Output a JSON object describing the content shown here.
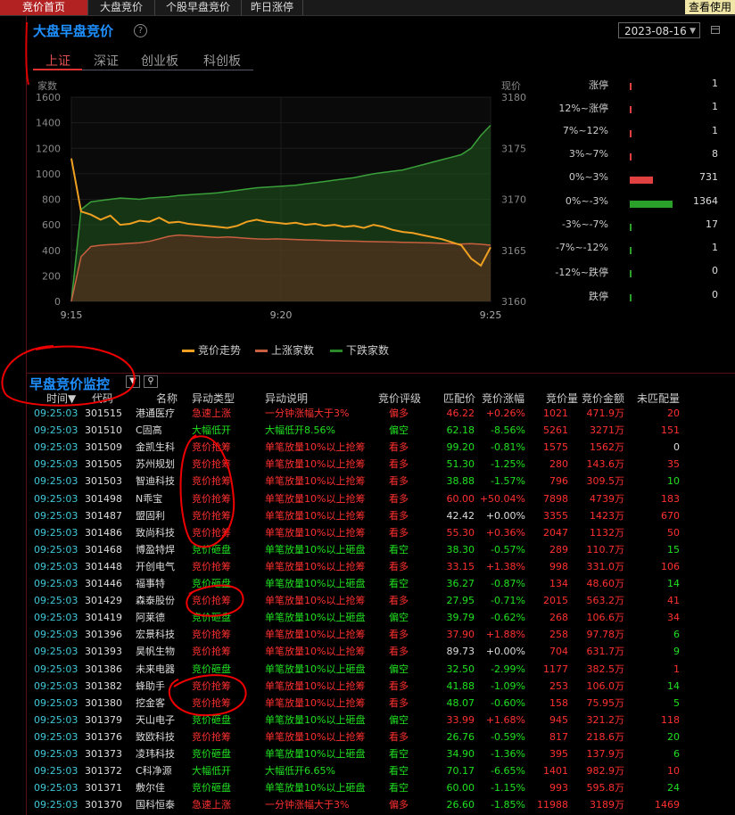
{
  "tabs": [
    "竞价首页",
    "大盘竞价",
    "个股早盘竞价",
    "昨日涨停"
  ],
  "help_label": "查看使用",
  "title": "大盘早盘竞价",
  "date": "2023-08-16",
  "markets": [
    "上证",
    "深证",
    "创业板",
    "科创板"
  ],
  "chart_data": {
    "type": "line",
    "x": [
      "9:15",
      "9:20",
      "9:25"
    ],
    "left_axis": {
      "label": "家数",
      "ticks": [
        1600,
        1400,
        1200,
        1000,
        800,
        600,
        400,
        200,
        0
      ]
    },
    "right_axis": {
      "label": "现价",
      "ticks": [
        3180,
        3175,
        3170,
        3165,
        3160
      ]
    },
    "series": [
      {
        "name": "竞价走势",
        "color": "#f0a020",
        "values": [
          3174,
          3168.8,
          3168.5,
          3168,
          3168.4,
          3167.5,
          3167.6,
          3167.9,
          3167.8,
          3168.2,
          3167.7,
          3167.8,
          3167.6,
          3167.5,
          3167.4,
          3167.3,
          3167.2,
          3167.4,
          3167.8,
          3168,
          3167.8,
          3167.7,
          3167.6,
          3167.7,
          3167.5,
          3167.6,
          3167.4,
          3167.5,
          3167.3,
          3167.4,
          3167.2,
          3167.5,
          3167.3,
          3167,
          3166.8,
          3166.7,
          3166.5,
          3166.3,
          3166.1,
          3165.8,
          3165.5,
          3164.2,
          3163.5,
          3165.3
        ]
      },
      {
        "name": "上涨家数",
        "color": "#c86040",
        "values": [
          0,
          350,
          430,
          440,
          445,
          450,
          455,
          460,
          470,
          490,
          510,
          520,
          515,
          510,
          505,
          500,
          505,
          500,
          495,
          490,
          488,
          490,
          488,
          485,
          482,
          480,
          478,
          476,
          474,
          472,
          470,
          468,
          466,
          465,
          463,
          462,
          460,
          458,
          455,
          452,
          450,
          452,
          448,
          440
        ]
      },
      {
        "name": "下跌家数",
        "color": "#2a8a2a",
        "values": [
          0,
          720,
          780,
          790,
          800,
          810,
          805,
          800,
          810,
          815,
          820,
          830,
          835,
          840,
          845,
          850,
          860,
          870,
          880,
          890,
          895,
          900,
          905,
          910,
          920,
          930,
          940,
          950,
          960,
          970,
          985,
          1000,
          1010,
          1020,
          1030,
          1050,
          1070,
          1090,
          1110,
          1130,
          1150,
          1200,
          1300,
          1380
        ]
      }
    ]
  },
  "legend": [
    "竞价走势",
    "上涨家数",
    "下跌家数"
  ],
  "distribution": [
    {
      "label": "涨停",
      "count": "1",
      "color": "#e04040",
      "frac": 0.002
    },
    {
      "label": "12%~涨停",
      "count": "1",
      "color": "#e04040",
      "frac": 0.002
    },
    {
      "label": "7%~12%",
      "count": "1",
      "color": "#e04040",
      "frac": 0.002
    },
    {
      "label": "3%~7%",
      "count": "8",
      "color": "#e04040",
      "frac": 0.006
    },
    {
      "label": "0%~3%",
      "count": "731",
      "color": "#e04040",
      "frac": 0.536
    },
    {
      "label": "0%~-3%",
      "count": "1364",
      "color": "#2aa02a",
      "frac": 1.0
    },
    {
      "label": "-3%~-7%",
      "count": "17",
      "color": "#2aa02a",
      "frac": 0.012
    },
    {
      "label": "-7%~-12%",
      "count": "1",
      "color": "#2aa02a",
      "frac": 0.002
    },
    {
      "label": "-12%~跌停",
      "count": "0",
      "color": "#2aa02a",
      "frac": 0.0
    },
    {
      "label": "跌停",
      "count": "0",
      "color": "#2aa02a",
      "frac": 0.0
    }
  ],
  "monitor": {
    "title": "早盘竞价监控",
    "headers": [
      "时间",
      "代码",
      "名称",
      "异动类型",
      "异动说明",
      "竞价评级",
      "匹配价",
      "竞价涨幅",
      "竞价量",
      "竞价金额",
      "未匹配量"
    ],
    "rows": [
      [
        "09:25:03",
        "301515",
        "港通医疗",
        "急速上涨",
        "一分钟涨幅大于3%",
        "偏多",
        "46.22",
        "+0.26%",
        "1021",
        "471.9万",
        "20"
      ],
      [
        "09:25:03",
        "301510",
        "C固高",
        "大幅低开",
        "大幅低开8.56%",
        "偏空",
        "62.18",
        "-8.56%",
        "5261",
        "3271万",
        "151"
      ],
      [
        "09:25:03",
        "301509",
        "金凯生科",
        "竞价抢筹",
        "单笔放量10%以上抢筹",
        "看多",
        "99.20",
        "-0.81%",
        "1575",
        "1562万",
        "0"
      ],
      [
        "09:25:03",
        "301505",
        "苏州规划",
        "竞价抢筹",
        "单笔放量10%以上抢筹",
        "看多",
        "51.30",
        "-1.25%",
        "280",
        "143.6万",
        "35"
      ],
      [
        "09:25:03",
        "301503",
        "智迪科技",
        "竞价抢筹",
        "单笔放量10%以上抢筹",
        "看多",
        "38.88",
        "-1.57%",
        "796",
        "309.5万",
        "10"
      ],
      [
        "09:25:03",
        "301498",
        "N乖宝",
        "竞价抢筹",
        "单笔放量10%以上抢筹",
        "看多",
        "60.00",
        "+50.04%",
        "7898",
        "4739万",
        "183"
      ],
      [
        "09:25:03",
        "301487",
        "盟固利",
        "竞价抢筹",
        "单笔放量10%以上抢筹",
        "看多",
        "42.42",
        "+0.00%",
        "3355",
        "1423万",
        "670"
      ],
      [
        "09:25:03",
        "301486",
        "致尚科技",
        "竞价抢筹",
        "单笔放量10%以上抢筹",
        "看多",
        "55.30",
        "+0.36%",
        "2047",
        "1132万",
        "50"
      ],
      [
        "09:25:03",
        "301468",
        "博盈特焊",
        "竞价砸盘",
        "单笔放量10%以上砸盘",
        "看空",
        "38.30",
        "-0.57%",
        "289",
        "110.7万",
        "15"
      ],
      [
        "09:25:03",
        "301448",
        "开创电气",
        "竞价抢筹",
        "单笔放量10%以上抢筹",
        "看多",
        "33.15",
        "+1.38%",
        "998",
        "331.0万",
        "106"
      ],
      [
        "09:25:03",
        "301446",
        "福事特",
        "竞价砸盘",
        "单笔放量10%以上砸盘",
        "看空",
        "36.27",
        "-0.87%",
        "134",
        "48.60万",
        "14"
      ],
      [
        "09:25:03",
        "301429",
        "森泰股份",
        "竞价抢筹",
        "单笔放量10%以上抢筹",
        "看多",
        "27.95",
        "-0.71%",
        "2015",
        "563.2万",
        "41"
      ],
      [
        "09:25:03",
        "301419",
        "阿莱德",
        "竞价砸盘",
        "单笔放量10%以上砸盘",
        "偏空",
        "39.79",
        "-0.62%",
        "268",
        "106.6万",
        "34"
      ],
      [
        "09:25:03",
        "301396",
        "宏景科技",
        "竞价抢筹",
        "单笔放量10%以上抢筹",
        "看多",
        "37.90",
        "+1.88%",
        "258",
        "97.78万",
        "6"
      ],
      [
        "09:25:03",
        "301393",
        "昊帆生物",
        "竞价抢筹",
        "单笔放量10%以上抢筹",
        "看多",
        "89.73",
        "+0.00%",
        "704",
        "631.7万",
        "9"
      ],
      [
        "09:25:03",
        "301386",
        "未来电器",
        "竞价砸盘",
        "单笔放量10%以上砸盘",
        "偏空",
        "32.50",
        "-2.99%",
        "1177",
        "382.5万",
        "1"
      ],
      [
        "09:25:03",
        "301382",
        "蜂助手",
        "竞价抢筹",
        "单笔放量10%以上抢筹",
        "看多",
        "41.88",
        "-1.09%",
        "253",
        "106.0万",
        "14"
      ],
      [
        "09:25:03",
        "301380",
        "挖金客",
        "竞价抢筹",
        "单笔放量10%以上抢筹",
        "看多",
        "48.07",
        "-0.60%",
        "158",
        "75.95万",
        "5"
      ],
      [
        "09:25:03",
        "301379",
        "天山电子",
        "竞价砸盘",
        "单笔放量10%以上砸盘",
        "偏空",
        "33.99",
        "+1.68%",
        "945",
        "321.2万",
        "118"
      ],
      [
        "09:25:03",
        "301376",
        "致欧科技",
        "竞价抢筹",
        "单笔放量10%以上抢筹",
        "看多",
        "26.76",
        "-0.59%",
        "817",
        "218.6万",
        "20"
      ],
      [
        "09:25:03",
        "301373",
        "凌玮科技",
        "竞价砸盘",
        "单笔放量10%以上砸盘",
        "看空",
        "34.90",
        "-1.36%",
        "395",
        "137.9万",
        "6"
      ],
      [
        "09:25:03",
        "301372",
        "C科净源",
        "大幅低开",
        "大幅低开6.65%",
        "看空",
        "70.17",
        "-6.65%",
        "1401",
        "982.9万",
        "10"
      ],
      [
        "09:25:03",
        "301371",
        "敷尔佳",
        "竞价砸盘",
        "单笔放量10%以上砸盘",
        "看空",
        "60.00",
        "-1.15%",
        "993",
        "595.8万",
        "24"
      ],
      [
        "09:25:03",
        "301370",
        "国科恒泰",
        "急速上涨",
        "一分钟涨幅大于3%",
        "偏多",
        "26.60",
        "-1.85%",
        "11988",
        "3189万",
        "1469"
      ]
    ]
  }
}
